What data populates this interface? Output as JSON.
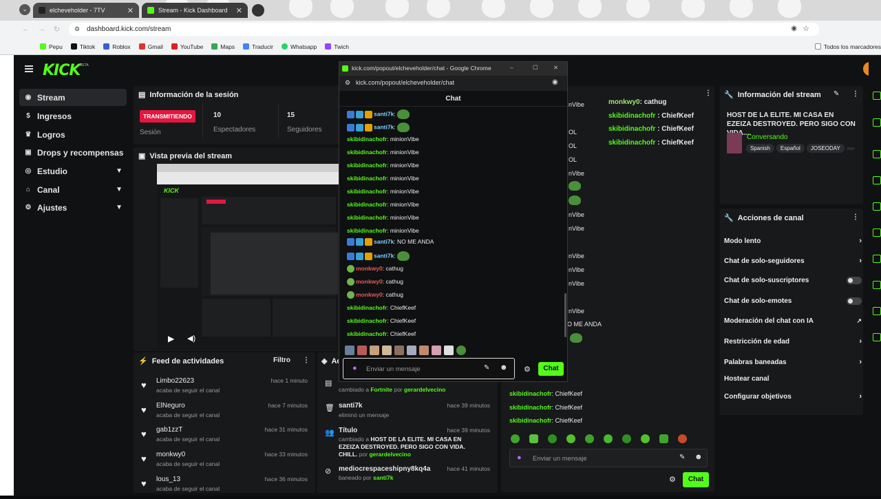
{
  "browser": {
    "tabs": [
      {
        "title": "elcheveholder - 7TV"
      },
      {
        "title": "Stream - Kick Dashboard"
      }
    ],
    "url": "dashboard.kick.com/stream",
    "bookmarks": [
      "Pepu",
      "Tiktok",
      "Roblox",
      "Gmail",
      "YouTube",
      "Maps",
      "Traducir",
      "Whatsapp",
      "Twich"
    ],
    "bookmarks_folder": "Todos los marcadores"
  },
  "app": {
    "logo": "KICK",
    "logo_badge": "BETA",
    "nav": [
      {
        "label": "Stream",
        "icon": "stream-icon"
      },
      {
        "label": "Ingresos",
        "icon": "coin-icon"
      },
      {
        "label": "Logros",
        "icon": "trophy-icon"
      },
      {
        "label": "Drops y recompensas",
        "icon": "gift-icon"
      },
      {
        "label": "Estudio",
        "icon": "studio-icon"
      },
      {
        "label": "Canal",
        "icon": "channel-icon"
      },
      {
        "label": "Ajustes",
        "icon": "gear-icon"
      }
    ]
  },
  "session": {
    "title": "Información de la sesión",
    "status": "TRANSMITIENDO",
    "status_label": "Sesión",
    "viewers_value": "10",
    "viewers_label": "Espectadores",
    "followers_value": "15",
    "followers_label": "Seguidores"
  },
  "preview": {
    "title": "Vista previa del stream"
  },
  "feed": {
    "title": "Feed de actividades",
    "filter": "Filtro",
    "items": [
      {
        "name": "Limbo22623",
        "sub": "acaba de seguir el canal",
        "time": "hace 1 minuto"
      },
      {
        "name": "ElNeguro",
        "sub": "acaba de seguir el canal",
        "time": "hace 7 minutos"
      },
      {
        "name": "gab1zzT",
        "sub": "acaba de seguir el canal",
        "time": "hace 31 minutos"
      },
      {
        "name": "monkwy0",
        "sub": "acaba de seguir el canal",
        "time": "hace 33 minutos"
      },
      {
        "name": "lous_13",
        "sub": "acaba de seguir el canal",
        "time": "hace 36 minutos"
      }
    ]
  },
  "modlog": {
    "title": "Ac",
    "row0_pre": "cambiado a",
    "row0_cat": "Fortnite",
    "row0_por": "por",
    "row0_user": "gerardelvecino",
    "items": [
      {
        "name": "santi7k",
        "sub": "eliminó un mensaje",
        "time": "hace 39 minutos"
      },
      {
        "name": "Título",
        "sub_pre": "cambiado a",
        "sub_bold": "HOST DE LA ELITE. MI CASA EN EZEIZA DESTROYED. PERO SIGO CON VIDA. CHILL.",
        "sub_por": "por",
        "sub_user": "gerardelvecino",
        "time": "hace 39 minutos"
      },
      {
        "name": "mediocrespaceshipny8kq4a",
        "sub_pre": "baneado por",
        "sub_user": "santi7k",
        "time": "hace 41 minutos"
      }
    ]
  },
  "dash_chat": {
    "top_lines": [
      {
        "user": "monkwy0",
        "msg": "cathug",
        "mod": true
      },
      {
        "user": "skibidinachofr",
        "msg": "ChiefKeef"
      },
      {
        "user": "skibidinachofr",
        "msg": "ChiefKeef"
      },
      {
        "user": "skibidinachofr",
        "msg": "ChiefKeef"
      }
    ],
    "left_fragments": [
      "nVibe",
      "OL",
      "OL",
      "OL",
      "nVibe",
      "nVibe",
      "nVibe",
      "nVibe",
      "nVibe",
      "nVibe",
      "nVibe",
      "O ME ANDA"
    ],
    "bottom_lines": [
      {
        "user": "skibidinachofr",
        "msg": "ChiefKeef"
      },
      {
        "user": "skibidinachofr",
        "msg": "ChiefKeef"
      },
      {
        "user": "skibidinachofr",
        "msg": "ChiefKeef"
      }
    ],
    "placeholder": "Enviar un mensaje",
    "send": "Chat"
  },
  "stream_info": {
    "title": "Información del stream",
    "stream_title": "HOST DE LA ELITE. MI CASA EN EZEIZA DESTROYED. PERO SIGO CON VIDA....",
    "category": "Conversando",
    "tags": [
      "Spanish",
      "Español",
      "JOSEODAY"
    ]
  },
  "channel_actions": {
    "title": "Acciones de canal",
    "items": [
      {
        "label": "Modo lento",
        "kind": "chevron"
      },
      {
        "label": "Chat de solo-seguidores",
        "kind": "chevron"
      },
      {
        "label": "Chat de solo-suscriptores",
        "kind": "toggle"
      },
      {
        "label": "Chat de solo-emotes",
        "kind": "toggle"
      },
      {
        "label": "Moderación del chat con IA",
        "kind": "external"
      },
      {
        "label": "Restricción de edad",
        "kind": "chevron"
      },
      {
        "label": "Palabras baneadas",
        "kind": "chevron"
      },
      {
        "label": "Hostear canal",
        "kind": "none"
      },
      {
        "label": "Configurar objetivos",
        "kind": "chevron"
      }
    ]
  },
  "popup": {
    "window_title": "kick.com/popout/elcheveholder/chat - Google Chrome",
    "url": "kick.com/popout/elcheveholder/chat",
    "header": "Chat",
    "lines": [
      {
        "user": "santi7k",
        "msg": "",
        "badges": true,
        "pepe": true
      },
      {
        "user": "santi7k",
        "msg": "",
        "badges": true,
        "pepe": true
      },
      {
        "user": "skibidinachofr",
        "msg": "minionVibe"
      },
      {
        "user": "skibidinachofr",
        "msg": "minionVibe"
      },
      {
        "user": "skibidinachofr",
        "msg": "minionVibe"
      },
      {
        "user": "skibidinachofr",
        "msg": "minionVibe"
      },
      {
        "user": "skibidinachofr",
        "msg": "minionVibe"
      },
      {
        "user": "skibidinachofr",
        "msg": "minionVibe"
      },
      {
        "user": "skibidinachofr",
        "msg": "minionVibe"
      },
      {
        "user": "skibidinachofr",
        "msg": "minionVibe"
      },
      {
        "user": "santi7k",
        "msg": "NO ME ANDA",
        "badges": true
      },
      {
        "user": "santi7k",
        "msg": "",
        "badges": true,
        "pepe": true
      },
      {
        "user": "monkwy0",
        "msg": "cathug",
        "mod": true
      },
      {
        "user": "monkwy0",
        "msg": "cathug",
        "mod": true
      },
      {
        "user": "monkwy0",
        "msg": "cathug",
        "mod": true
      },
      {
        "user": "skibidinachofr",
        "msg": "ChiefKeef"
      },
      {
        "user": "skibidinachofr",
        "msg": "ChiefKeef"
      },
      {
        "user": "skibidinachofr",
        "msg": "ChiefKeef"
      }
    ],
    "placeholder": "Enviar un mensaje",
    "send": "Chat"
  },
  "colors": {
    "accent": "#53fc18",
    "live": "#e5173f",
    "bg": "#101112",
    "panel": "#18191b"
  }
}
